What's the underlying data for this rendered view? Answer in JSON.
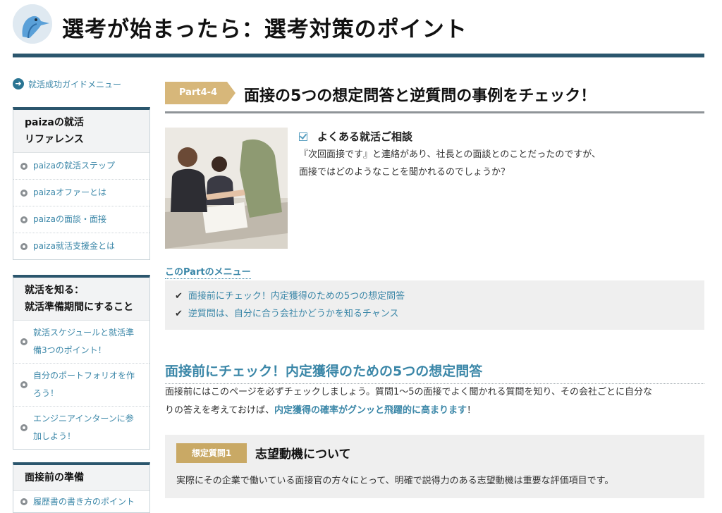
{
  "header": {
    "site_title": "選考が始まったら：選考対策のポイント",
    "logo_icon": "bird-logo-icon",
    "accent_color": "#2b566d"
  },
  "sidebar": {
    "guide_link": "就活成功ガイドメニュー",
    "boxes": [
      {
        "title_line1": "paizaの就活",
        "title_line2": "リファレンス",
        "items": [
          "paizaの就活ステップ",
          "paizaオファーとは",
          "paizaの面談・面接",
          "paiza就活支援金とは"
        ]
      },
      {
        "title_line1": "就活を知る：",
        "title_line2": "就活準備期間にすること",
        "items": [
          {
            "line1": "就活スケジュールと就活準",
            "line2": "備3つのポイント！"
          },
          {
            "line1": "自分のポートフォリオを作",
            "line2": "ろう！"
          },
          {
            "line1": "エンジニアインターンに参",
            "line2": "加しよう！"
          }
        ]
      },
      {
        "title_line1": "面接前の準備",
        "items": [
          "履歴書の書き方のポイント"
        ]
      }
    ]
  },
  "main": {
    "part_tag": "Part4-4",
    "part_title": "面接の5つの想定問答と逆質問の事例をチェック！",
    "consult": {
      "title": "よくある就活ご相談",
      "line1": "『次回面接です』と連絡があり、社長との面談とのことだったのですが、",
      "line2": "面接ではどのようなことを聞かれるのでしょうか？"
    },
    "menu_label": "このPartのメニュー",
    "menu_items": [
      "面接前にチェック！内定獲得のための5つの想定問答",
      "逆質問は、自分に合う会社かどうかを知るチャンス"
    ],
    "section_title": "面接前にチェック！内定獲得のための5つの想定問答",
    "section_body_1": "面接前にはこのページを必ずチェックしましょう。質問1〜5の面接でよく聞かれる質問を知り、その会社ごとに自分な",
    "section_body_2a": "りの答えを考えておけば、",
    "section_body_2b": "内定獲得の確率がグンッと飛躍的に高まります",
    "section_body_2c": "！",
    "question": {
      "tag": "想定質問1",
      "title": "志望動機について",
      "body": "実際にその企業で働いている面接官の方々にとって、明確で説得力のある志望動機は重要な評価項目です。"
    }
  }
}
